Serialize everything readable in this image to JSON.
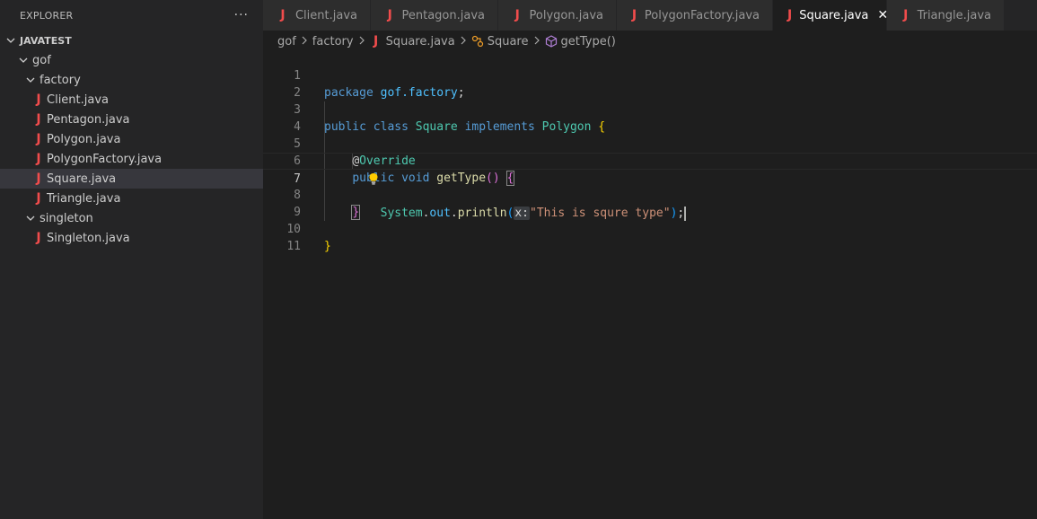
{
  "explorer": {
    "title": "EXPLORER",
    "more_label": "···",
    "project": "JAVATEST",
    "tree": {
      "gof": "gof",
      "factory": "factory",
      "files_factory": [
        "Client.java",
        "Pentagon.java",
        "Polygon.java",
        "PolygonFactory.java",
        "Square.java",
        "Triangle.java"
      ],
      "singleton": "singleton",
      "files_singleton": [
        "Singleton.java"
      ]
    }
  },
  "tabs": [
    {
      "label": "Client.java"
    },
    {
      "label": "Pentagon.java"
    },
    {
      "label": "Polygon.java"
    },
    {
      "label": "PolygonFactory.java"
    },
    {
      "label": "Square.java",
      "active": true
    },
    {
      "label": "Triangle.java"
    }
  ],
  "tab_close_glyph": "✕",
  "breadcrumb": [
    "gof",
    "factory",
    "Square.java",
    "Square",
    "getType()"
  ],
  "editor": {
    "line_numbers": [
      "1",
      "2",
      "3",
      "4",
      "5",
      "6",
      "7",
      "8",
      "9",
      "10",
      "11"
    ],
    "current_line": 7,
    "code": {
      "l1_kw": "package",
      "l1_pkg": "gof.factory",
      "l1_semi": ";",
      "l3_public": "public",
      "l3_class": "class",
      "l3_name": "Square",
      "l3_impl": "implements",
      "l3_iface": "Polygon",
      "l3_brace": "{",
      "l5_at": "@",
      "l5_ann": "Override",
      "l6_public": "public",
      "l6_void": "void",
      "l6_fn": "getType",
      "l6_parens": "()",
      "l6_brace": "{",
      "l7_sys": "System",
      "l7_out": "out",
      "l7_fn": "println",
      "l7_open": "(",
      "l7_hint": "x:",
      "l7_str": "\"This is squre type\"",
      "l7_close": ")",
      "l7_semi": ";",
      "l8_brace": "}",
      "l10_brace": "}"
    }
  },
  "colors": {
    "java_icon": "#f14c4c",
    "keyword": "#569cd6",
    "type": "#4ec9b0",
    "function": "#dcdcaa",
    "string": "#ce9178",
    "bulb": "#ffcc00"
  }
}
